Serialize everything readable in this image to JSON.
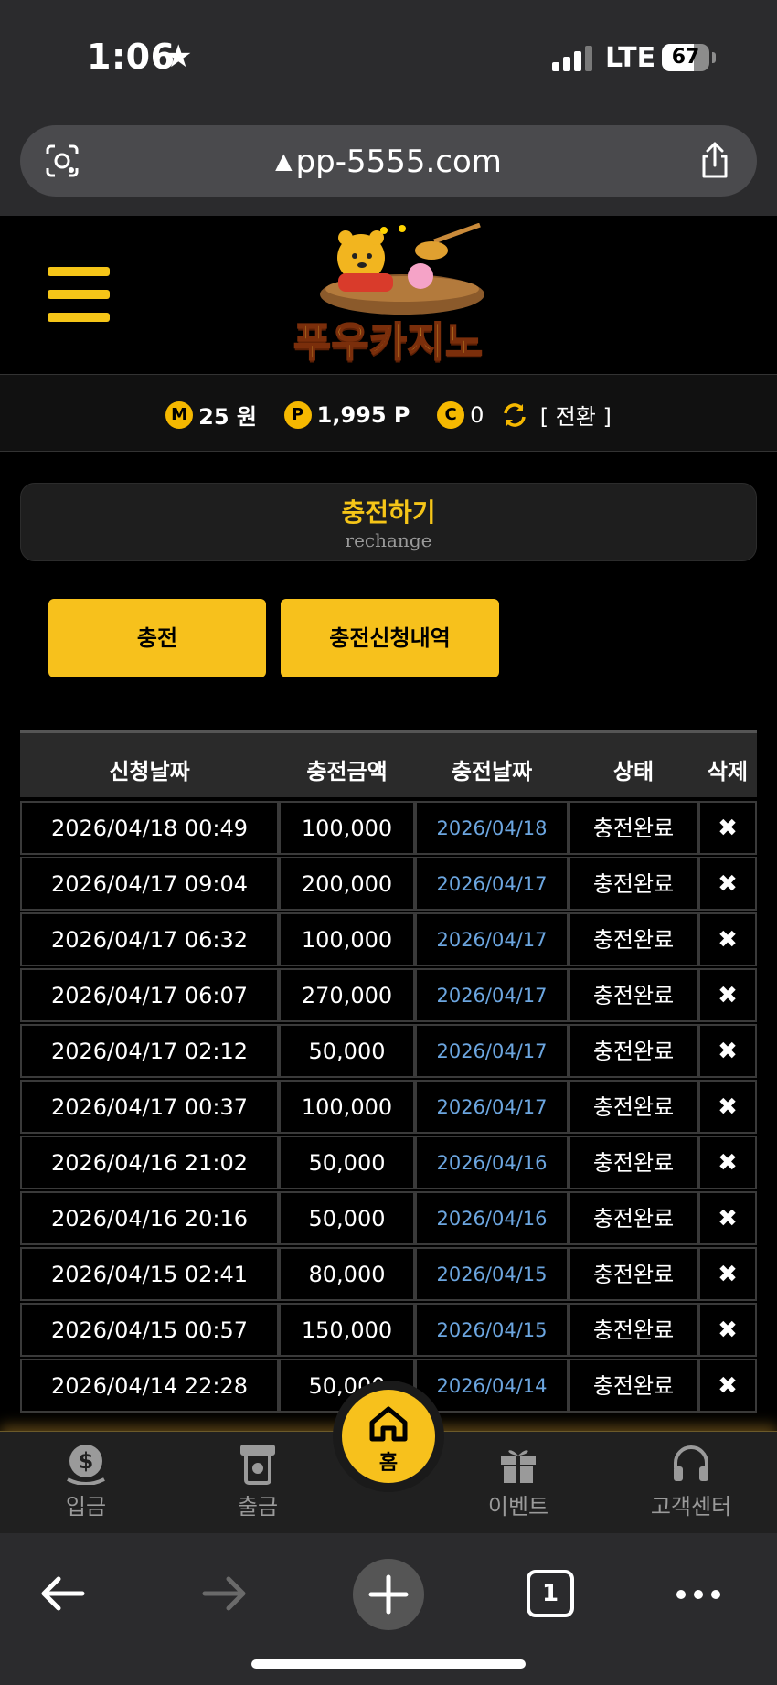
{
  "status_bar": {
    "time": "1:06",
    "network": "LTE",
    "battery": "67",
    "battery_level": 0.67
  },
  "browser": {
    "url": "pp-5555.com",
    "open_tabs": "1"
  },
  "site": {
    "logo_text": "푸우카지노"
  },
  "balance": {
    "money_badge": "M",
    "money": "25 원",
    "point_badge": "P",
    "points": "1,995 P",
    "casino_badge": "C",
    "casino": "0",
    "convert_label": "[ 전환 ]"
  },
  "page": {
    "title": "충전하기",
    "subtitle": "rechange"
  },
  "actions": {
    "charge_label": "충전",
    "history_label": "충전신청내역"
  },
  "table": {
    "headers": [
      "신청날짜",
      "충전금액",
      "충전날짜",
      "상태",
      "삭제"
    ],
    "rows": [
      {
        "requested": "2026/04/18 00:49",
        "amount": "100,000",
        "charged": "2026/04/18",
        "status": "충전완료"
      },
      {
        "requested": "2026/04/17 09:04",
        "amount": "200,000",
        "charged": "2026/04/17",
        "status": "충전완료"
      },
      {
        "requested": "2026/04/17 06:32",
        "amount": "100,000",
        "charged": "2026/04/17",
        "status": "충전완료"
      },
      {
        "requested": "2026/04/17 06:07",
        "amount": "270,000",
        "charged": "2026/04/17",
        "status": "충전완료"
      },
      {
        "requested": "2026/04/17 02:12",
        "amount": "50,000",
        "charged": "2026/04/17",
        "status": "충전완료"
      },
      {
        "requested": "2026/04/17 00:37",
        "amount": "100,000",
        "charged": "2026/04/17",
        "status": "충전완료"
      },
      {
        "requested": "2026/04/16 21:02",
        "amount": "50,000",
        "charged": "2026/04/16",
        "status": "충전완료"
      },
      {
        "requested": "2026/04/16 20:16",
        "amount": "50,000",
        "charged": "2026/04/16",
        "status": "충전완료"
      },
      {
        "requested": "2026/04/15 02:41",
        "amount": "80,000",
        "charged": "2026/04/15",
        "status": "충전완료"
      },
      {
        "requested": "2026/04/15 00:57",
        "amount": "150,000",
        "charged": "2026/04/15",
        "status": "충전완료"
      },
      {
        "requested": "2026/04/14 22:28",
        "amount": "50,000",
        "charged": "2026/04/14",
        "status": "충전완료"
      }
    ],
    "delete_icon": "close-icon"
  },
  "bottom_nav": {
    "deposit": "입금",
    "withdraw": "출금",
    "home": "홈",
    "event": "이벤트",
    "support": "고객센터"
  },
  "colors": {
    "accent": "#f7c11c",
    "date_link": "#6ca6e0",
    "background": "#000000"
  }
}
